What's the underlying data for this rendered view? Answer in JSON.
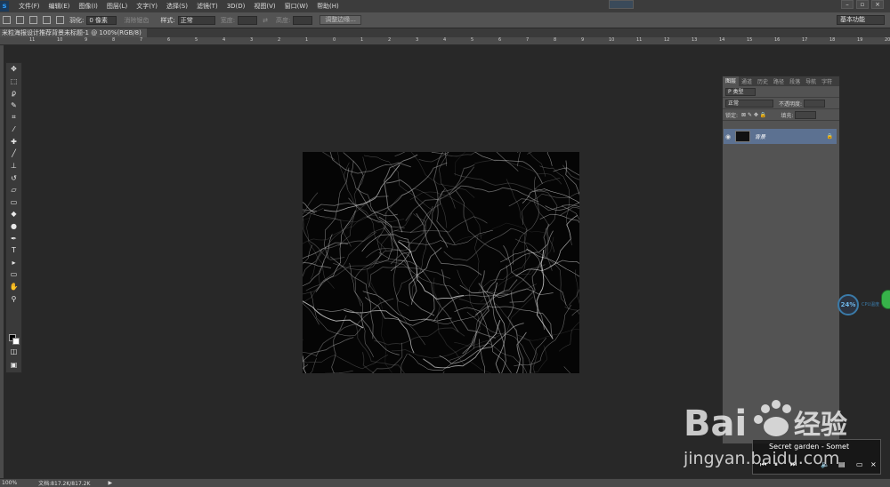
{
  "menubar": {
    "logo": "s",
    "items": [
      "文件(F)",
      "编辑(E)",
      "图像(I)",
      "图层(L)",
      "文字(Y)",
      "选择(S)",
      "滤镜(T)",
      "3D(D)",
      "视图(V)",
      "窗口(W)",
      "帮助(H)"
    ]
  },
  "options": {
    "feather_label": "羽化:",
    "feather_value": "0 像素",
    "antialias_label": "消除锯齿",
    "style_label": "样式:",
    "style_value": "正常",
    "width_label": "宽度:",
    "height_label": "高度:",
    "refine_button": "调整边缘...",
    "workspace": "基本功能"
  },
  "document": {
    "tab_title": "未标题-1 @ 100%(RGB/8)",
    "tab_title_prefix": "米粒海报设计推荐背景",
    "zoom": "100%",
    "doc_size": "文档:817.2K/817.2K"
  },
  "ruler": {
    "ticks": [
      "11",
      "10",
      "9",
      "8",
      "7",
      "6",
      "5",
      "4",
      "3",
      "2",
      "1",
      "0",
      "1",
      "2",
      "3",
      "4",
      "5",
      "6",
      "7",
      "8",
      "9",
      "10",
      "11",
      "12",
      "13",
      "14",
      "15",
      "16",
      "17",
      "18",
      "19",
      "20"
    ]
  },
  "layers_panel": {
    "tabs": [
      "图层",
      "通道",
      "历史",
      "路径",
      "段落",
      "导航",
      "字符"
    ],
    "filter_label": "P 类型",
    "blend_mode": "正常",
    "opacity_label": "不透明度:",
    "lock_label": "锁定:",
    "fill_label": "填充:",
    "layer_name": "背景"
  },
  "cpu": {
    "value": "24%",
    "label": "CPU温度"
  },
  "player": {
    "song": "Secret garden - Somet"
  },
  "watermark": {
    "brand": "Bai",
    "brand2": "经验",
    "url": "jingyan.baidu.com"
  },
  "colors": {
    "accent": "#5c7191",
    "canvas": "#050505"
  }
}
